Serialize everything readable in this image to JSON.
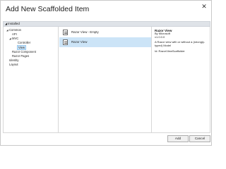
{
  "window": {
    "title": "Add New Scaffolded Item",
    "close_glyph": "✕"
  },
  "section": {
    "label": "Installed",
    "toggle_glyph": "◢"
  },
  "tree": {
    "items": [
      {
        "label": "Common",
        "expander": "◢"
      },
      {
        "label": "API",
        "expander": ""
      },
      {
        "label": "MVC",
        "expander": "◢"
      },
      {
        "label": "Controller",
        "expander": ""
      },
      {
        "label": "View",
        "expander": ""
      },
      {
        "label": "Razor Component",
        "expander": ""
      },
      {
        "label": "Razor Pages",
        "expander": ""
      },
      {
        "label": "Identity",
        "expander": ""
      },
      {
        "label": "Layout",
        "expander": ""
      }
    ]
  },
  "templates": {
    "items": [
      {
        "label": "Razor View - Empty"
      },
      {
        "label": "Razor View"
      }
    ]
  },
  "details": {
    "title": "Razor View",
    "author": "By Microsoft",
    "version": "v1.0.0.0",
    "description_line1": "A Razor view with or without a (strongly-",
    "description_line2": "typed) Model",
    "id": "Id: RazorViewScaffolder"
  },
  "buttons": {
    "add": "Add",
    "cancel": "Cancel"
  },
  "colors": {
    "selection": "#cce4f7",
    "section_header": "#dfe3e8"
  }
}
